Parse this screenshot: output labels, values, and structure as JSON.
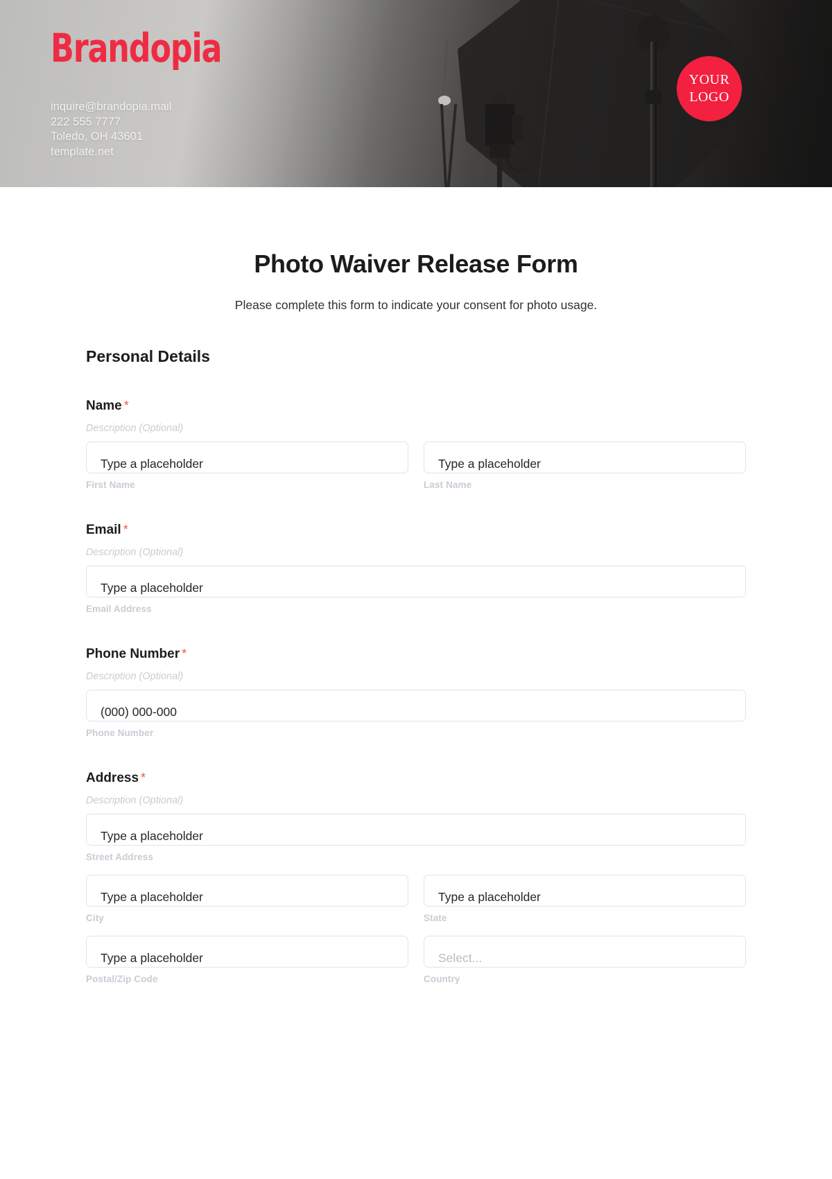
{
  "header": {
    "brand_name": "Brandopia",
    "contact": [
      "inquire@brandopia.mail",
      "222 555 7777",
      "Toledo, OH 43601",
      "template.net"
    ],
    "logo_badge_line1": "YOUR",
    "logo_badge_line2": "LOGO",
    "brand_color": "#ef2b43",
    "badge_color": "#f32040"
  },
  "form": {
    "title": "Photo Waiver Release Form",
    "subtitle": "Please complete this form to indicate your consent for photo usage.",
    "section_title": "Personal Details",
    "required_marker": "*",
    "description_text": "Description (Optional)",
    "default_placeholder": "Type a placeholder",
    "fields": [
      {
        "label": "Name",
        "required": true,
        "description": "Description (Optional)",
        "inputs": [
          {
            "placeholder": "Type a placeholder",
            "sub_label": "First Name",
            "type": "text"
          },
          {
            "placeholder": "Type a placeholder",
            "sub_label": "Last Name",
            "type": "text"
          }
        ]
      },
      {
        "label": "Email",
        "required": true,
        "description": "Description (Optional)",
        "inputs": [
          {
            "placeholder": "Type a placeholder",
            "sub_label": "Email Address",
            "type": "text"
          }
        ]
      },
      {
        "label": "Phone Number",
        "required": true,
        "description": "Description (Optional)",
        "inputs": [
          {
            "placeholder": "(000) 000-000",
            "sub_label": "Phone Number",
            "type": "text"
          }
        ]
      },
      {
        "label": "Address",
        "required": true,
        "description": "Description (Optional)",
        "inputs": [
          {
            "placeholder": "Type a placeholder",
            "sub_label": "Street Address",
            "type": "text"
          },
          {
            "placeholder": "Type a placeholder",
            "sub_label": "City",
            "type": "text"
          },
          {
            "placeholder": "Type a placeholder",
            "sub_label": "State",
            "type": "text"
          },
          {
            "placeholder": "Type a placeholder",
            "sub_label": "Postal/Zip Code",
            "type": "text"
          },
          {
            "placeholder": "Select...",
            "sub_label": "Country",
            "type": "select"
          }
        ]
      }
    ]
  }
}
